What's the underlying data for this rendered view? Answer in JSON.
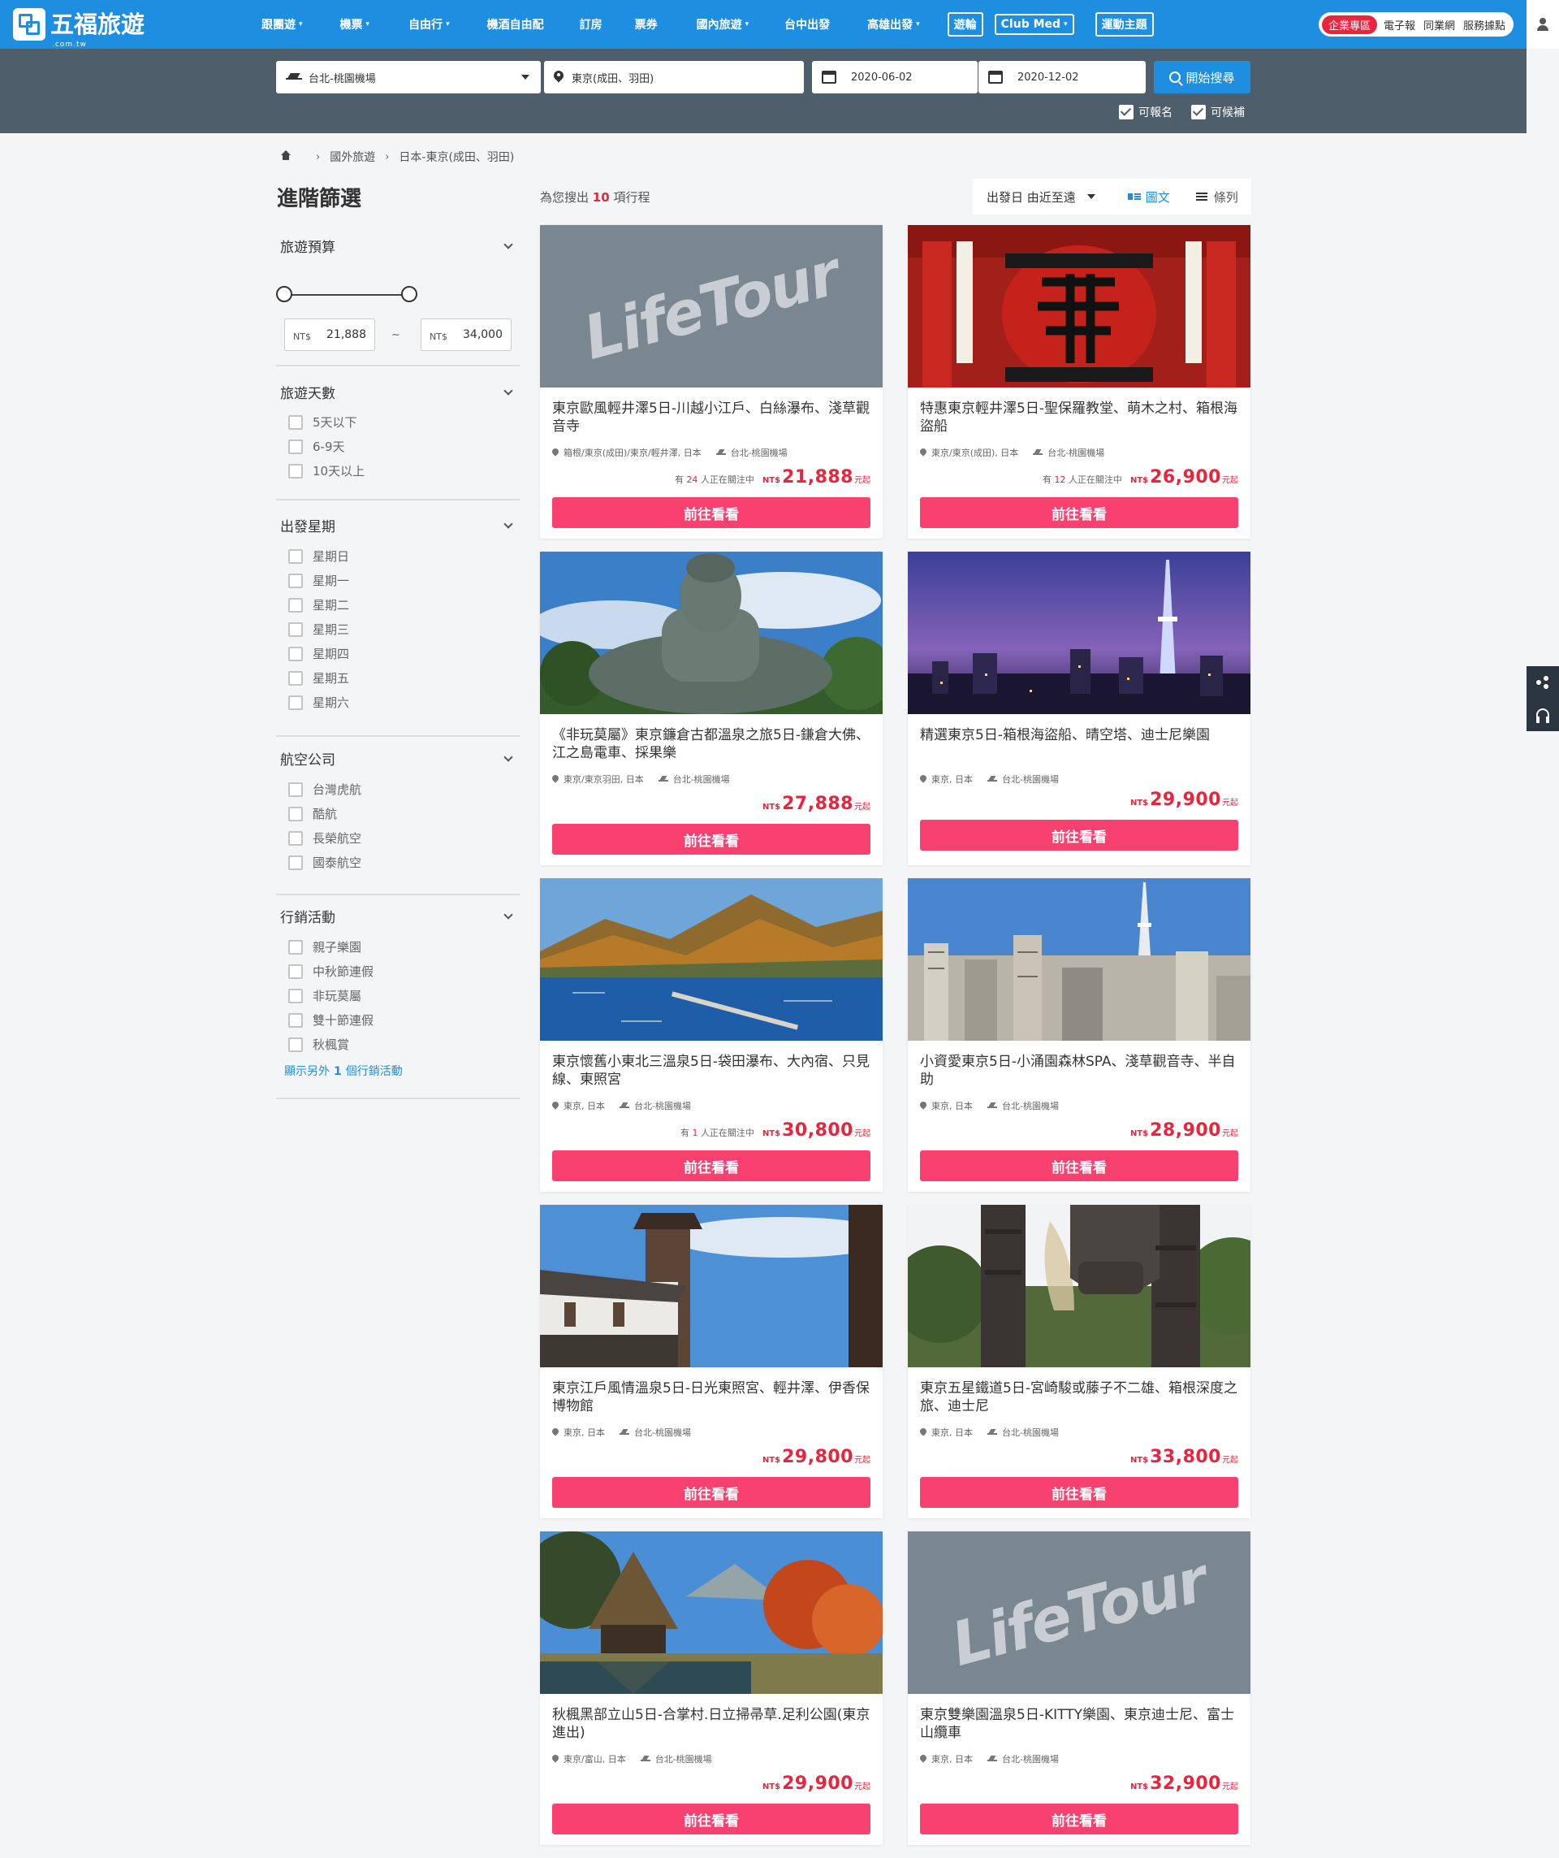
{
  "brand": {
    "name": "五福旅遊",
    "domain": ".com.tw"
  },
  "nav": {
    "items": [
      {
        "label": "跟團遊",
        "dropdown": true
      },
      {
        "label": "機票",
        "dropdown": true
      },
      {
        "label": "自由行",
        "dropdown": true
      },
      {
        "label": "機酒自由配",
        "dropdown": false
      },
      {
        "label": "訂房",
        "dropdown": false
      },
      {
        "label": "票券",
        "dropdown": false
      },
      {
        "label": "國內旅遊",
        "dropdown": true
      },
      {
        "label": "台中出發",
        "dropdown": false
      },
      {
        "label": "高雄出發",
        "dropdown": true
      }
    ],
    "boxed": [
      {
        "label": "遊輪",
        "dropdown": false
      },
      {
        "label": "Club Med",
        "dropdown": true
      },
      {
        "label": "運動主題",
        "dropdown": false
      }
    ],
    "corporate": "企業專區",
    "links": [
      "電子報",
      "同業網",
      "服務據點"
    ]
  },
  "search": {
    "from": "台北-桃園機場",
    "to": "東京(成田、羽田)",
    "date_from": "2020-06-02",
    "date_to": "2020-12-02",
    "button": "開始搜尋",
    "check_available": "可報名",
    "check_waitlist": "可候補"
  },
  "breadcrumb": [
    "國外旅遊",
    "日本-東京(成田、羽田)"
  ],
  "filters": {
    "title": "進階篩選",
    "budget": {
      "title": "旅遊預算",
      "currency": "NT$",
      "min": "21,888",
      "max": "34,000",
      "separator": "~"
    },
    "days": {
      "title": "旅遊天數",
      "options": [
        "5天以下",
        "6-9天",
        "10天以上"
      ]
    },
    "weekday": {
      "title": "出發星期",
      "options": [
        "星期日",
        "星期一",
        "星期二",
        "星期三",
        "星期四",
        "星期五",
        "星期六"
      ]
    },
    "airline": {
      "title": "航空公司",
      "options": [
        "台灣虎航",
        "酷航",
        "長榮航空",
        "國泰航空"
      ]
    },
    "marketing": {
      "title": "行銷活動",
      "options": [
        "親子樂園",
        "中秋節連假",
        "非玩莫屬",
        "雙十節連假",
        "秋楓賞"
      ],
      "more_prefix": "顯示另外",
      "more_count": "1",
      "more_suffix": "個行銷活動"
    }
  },
  "results": {
    "prefix": "為您搜出",
    "count": "10",
    "suffix": "項行程",
    "sort": "出發日 由近至遠",
    "view_grid": "圖文",
    "view_list": "條列"
  },
  "card_labels": {
    "watch_prefix": "有",
    "watch_suffix": "人正在關注中",
    "currency": "NT$",
    "unit": "元起",
    "button": "前往看看"
  },
  "cards": [
    {
      "title": "東京歐風輕井澤5日-川越小江戶、白絲瀑布、淺草觀音寺",
      "place": "箱根/東京(成田)/東京/輕井澤, 日本",
      "airport": "台北-桃園機場",
      "watchers": "24",
      "price": "21,888",
      "image": "lifetour-placeholder"
    },
    {
      "title": "特惠東京輕井澤5日-聖保羅教堂、萌木之村、箱根海盜船",
      "place": "東京/東京(成田), 日本",
      "airport": "台北-桃園機場",
      "watchers": "12",
      "price": "26,900",
      "image": "sensoji-lantern"
    },
    {
      "title": "《非玩莫屬》東京鐮倉古都溫泉之旅5日-鎌倉大佛、江之島電車、採果樂",
      "place": "東京/東京羽田, 日本",
      "airport": "台北-桃園機場",
      "watchers": "",
      "price": "27,888",
      "image": "kamakura-buddha"
    },
    {
      "title": "精選東京5日-箱根海盜船、晴空塔、迪士尼樂園",
      "place": "東京, 日本",
      "airport": "台北-桃園機場",
      "watchers": "",
      "price": "29,900",
      "image": "skytree-night"
    },
    {
      "title": "東京懷舊小東北三溫泉5日-袋田瀑布、大內宿、只見線、東照宮",
      "place": "東京, 日本",
      "airport": "台北-桃園機場",
      "watchers": "1",
      "price": "30,800",
      "image": "autumn-lake"
    },
    {
      "title": "小資愛東京5日-小涌園森林SPA、淺草觀音寺、半自助",
      "place": "東京, 日本",
      "airport": "台北-桃園機場",
      "watchers": "",
      "price": "28,900",
      "image": "tokyo-skyline"
    },
    {
      "title": "東京江戶風情溫泉5日-日光東照宮、輕井澤、伊香保博物館",
      "place": "東京, 日本",
      "airport": "台北-桃園機場",
      "watchers": "",
      "price": "29,800",
      "image": "bell-tower"
    },
    {
      "title": "東京五星鐵道5日-宮崎駿或藤子不二雄、箱根深度之旅、迪士尼",
      "place": "東京, 日本",
      "airport": "台北-桃園機場",
      "watchers": "",
      "price": "33,800",
      "image": "robot-statue"
    },
    {
      "title": "秋楓黑部立山5日-合掌村.日立掃帚草.足利公園(東京進出)",
      "place": "東京/富山, 日本",
      "airport": "台北-桃園機場",
      "watchers": "",
      "price": "29,900",
      "image": "gassho-village"
    },
    {
      "title": "東京雙樂園溫泉5日-KITTY樂園、東京迪士尼、富士山纜車",
      "place": "東京, 日本",
      "airport": "台北-桃園機場",
      "watchers": "",
      "price": "32,900",
      "image": "lifetour-placeholder"
    }
  ],
  "placeholder_logo": "LifeTour",
  "colors": {
    "primary": "#1e8fe0",
    "search_band": "#4e5e6b",
    "accent_pink": "#f8416f",
    "price_red": "#e8253d"
  }
}
